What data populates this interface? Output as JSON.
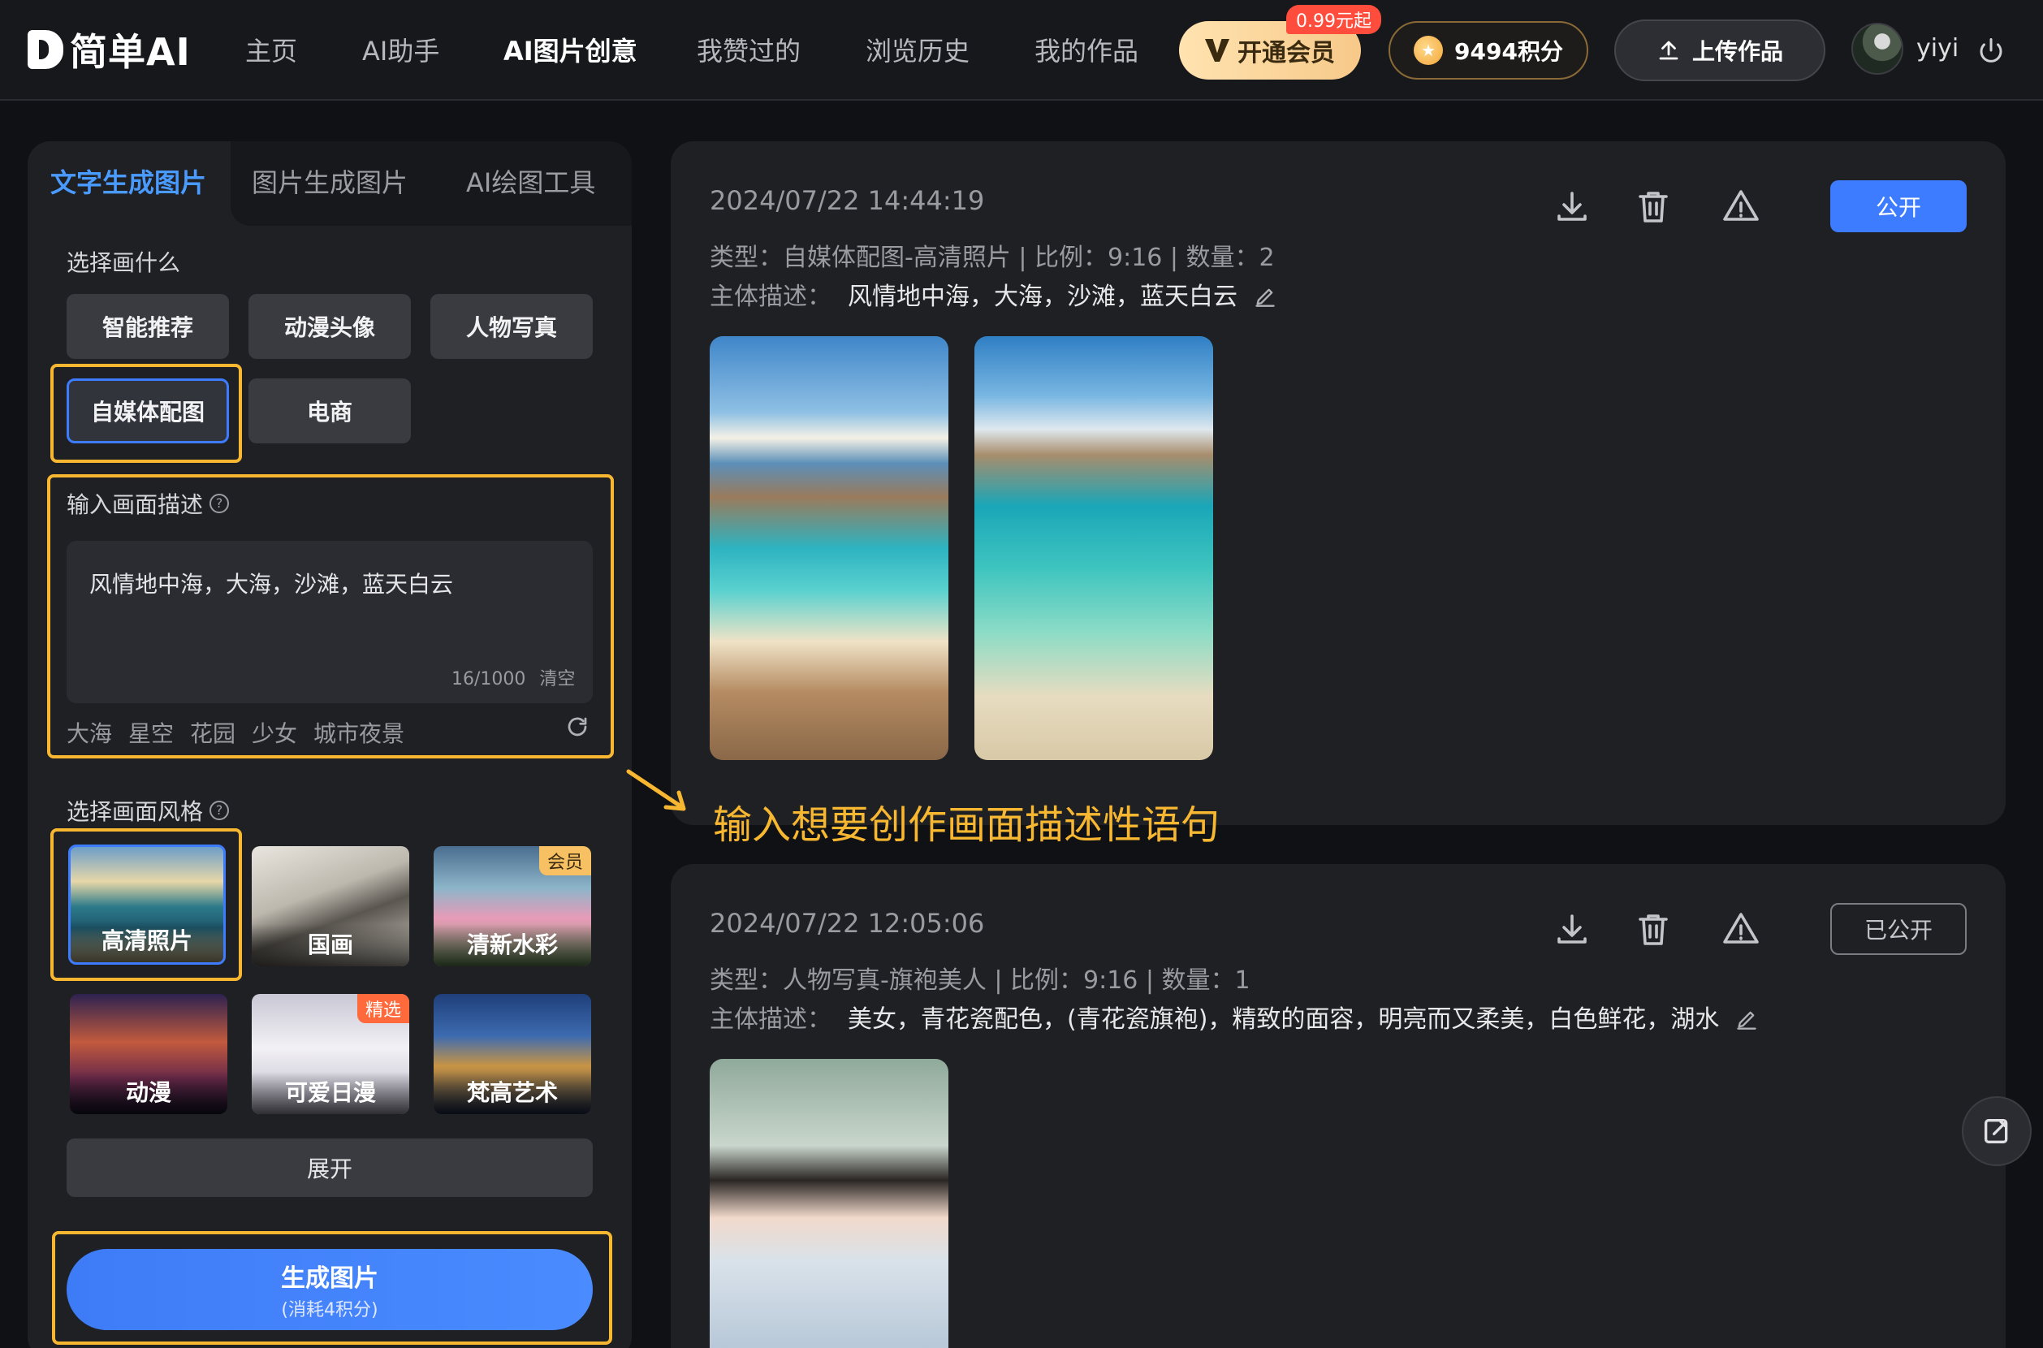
{
  "app": {
    "logo_text": "简单AI"
  },
  "nav": {
    "items": [
      {
        "label": "主页"
      },
      {
        "label": "AI助手"
      },
      {
        "label": "AI图片创意"
      },
      {
        "label": "我赞过的"
      },
      {
        "label": "浏览历史"
      },
      {
        "label": "我的作品"
      }
    ],
    "active_index": 2
  },
  "header": {
    "vip_label": "开通会员",
    "vip_badge": "0.99元起",
    "points_label": "9494积分",
    "upload_label": "上传作品",
    "username": "yiyi"
  },
  "left": {
    "tabs": [
      {
        "label": "文字生成图片"
      },
      {
        "label": "图片生成图片"
      },
      {
        "label": "AI绘图工具"
      }
    ],
    "section_what": "选择画什么",
    "categories": [
      {
        "label": "智能推荐"
      },
      {
        "label": "动漫头像"
      },
      {
        "label": "人物写真"
      },
      {
        "label": "自媒体配图"
      },
      {
        "label": "电商"
      }
    ],
    "section_desc": "输入画面描述",
    "prompt_value": "风情地中海，大海，沙滩，蓝天白云",
    "counter": "16/1000",
    "clear_label": "清空",
    "suggestions": [
      "大海",
      "星空",
      "花园",
      "少女",
      "城市夜景"
    ],
    "section_style": "选择画面风格",
    "styles": [
      {
        "label": "高清照片"
      },
      {
        "label": "国画"
      },
      {
        "label": "清新水彩",
        "badge": "会员"
      },
      {
        "label": "动漫"
      },
      {
        "label": "可爱日漫",
        "badge": "精选"
      },
      {
        "label": "梵高艺术"
      }
    ],
    "expand_label": "展开",
    "generate_label": "生成图片",
    "generate_sub": "(消耗4积分)"
  },
  "cards": [
    {
      "time": "2024/07/22 14:44:19",
      "meta": "类型：自媒体配图-高清照片 | 比例：9:16 | 数量：2",
      "desc_label": "主体描述：",
      "desc_value": "风情地中海，大海，沙滩，蓝天白云",
      "public_label": "公开"
    },
    {
      "time": "2024/07/22 12:05:06",
      "meta": "类型：人物写真-旗袍美人 | 比例：9:16 | 数量：1",
      "desc_label": "主体描述：",
      "desc_value": "美女，青花瓷配色，(青花瓷旗袍)，精致的面容，明亮而又柔美，白色鲜花，湖水",
      "public_label": "已公开"
    }
  ],
  "annotation": "输入想要创作画面描述性语句",
  "colors": {
    "accent": "#3d7bff",
    "highlight": "#f7b731",
    "background": "#101114",
    "panel": "#1f2024"
  },
  "icons": {
    "download": "download-icon",
    "delete": "trash-icon",
    "report": "warning-icon",
    "edit": "pencil-icon",
    "power": "power-icon",
    "upload": "upload-icon",
    "refresh": "refresh-icon",
    "help": "help-circle-icon",
    "float": "edit-note-icon"
  }
}
